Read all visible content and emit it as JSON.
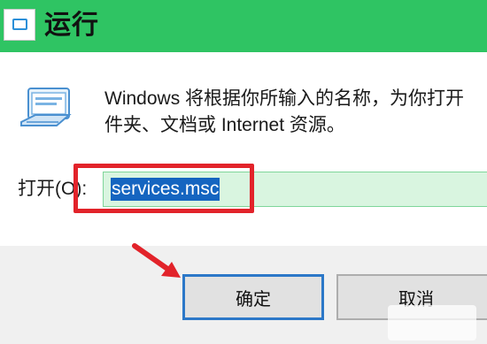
{
  "window": {
    "title": "运行",
    "icon": "run-app-icon"
  },
  "dialog": {
    "icon": "run-dialog-icon",
    "description": "Windows 将根据你所输入的名称，为你打开\n件夹、文档或 Internet 资源。",
    "open_label": "打开(O):",
    "open_value": "services.msc"
  },
  "buttons": {
    "ok_label": "确定",
    "cancel_label": "取消"
  },
  "annotations": {
    "highlight_color": "#e2232a",
    "arrow_color": "#e2232a"
  },
  "colors": {
    "titlebar": "#2fc463",
    "selection": "#1565c0",
    "input_bg": "#d9f5e0"
  }
}
